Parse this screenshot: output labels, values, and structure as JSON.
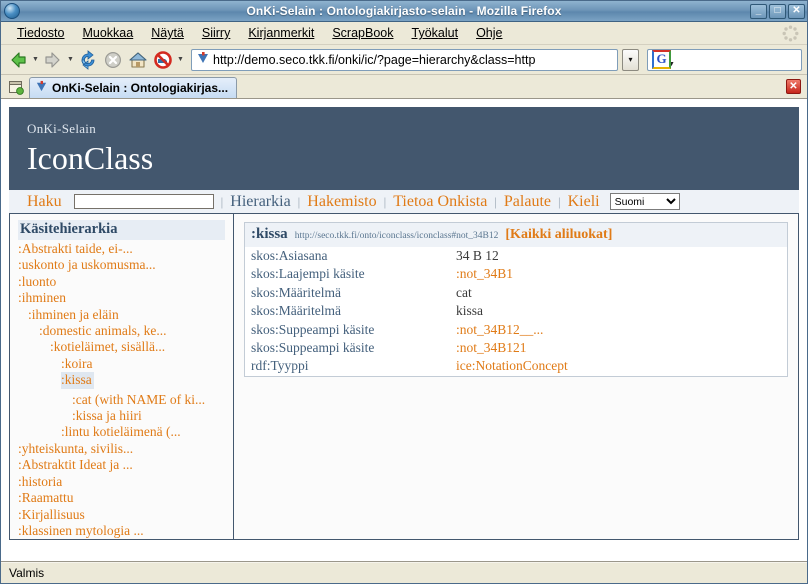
{
  "window": {
    "title": "OnKi-Selain : Ontologiakirjasto-selain - Mozilla Firefox",
    "app_icon": "firefox-globe-icon",
    "minimize": "_",
    "maximize": "□",
    "close": "✕"
  },
  "menubar": {
    "items": [
      {
        "label": "Tiedosto",
        "accel": "T"
      },
      {
        "label": "Muokkaa",
        "accel": "M"
      },
      {
        "label": "Näytä",
        "accel": "N"
      },
      {
        "label": "Siirry",
        "accel": "S"
      },
      {
        "label": "Kirjanmerkit",
        "accel": "K"
      },
      {
        "label": "ScrapBook",
        "accel": "S"
      },
      {
        "label": "Työkalut",
        "accel": "T"
      },
      {
        "label": "Ohje",
        "accel": "O"
      }
    ]
  },
  "toolbar": {
    "back": "back-arrow",
    "forward": "forward-arrow",
    "reload": "reload-icon",
    "stop": "stop-icon",
    "home": "home-icon",
    "adblock": "adblock-icon",
    "url": "http://demo.seco.tkk.fi/onki/ic/?page=hierarchy&class=http",
    "url_dropdown": "▾",
    "search_placeholder": "",
    "search_value": "",
    "search_engine": "G"
  },
  "tabbar": {
    "list_all_tabs": "list-all-tabs-icon",
    "tab_label": "OnKi-Selain : Ontologiakirjas...",
    "close_label": "✕"
  },
  "page": {
    "brand_small": "OnKi-Selain",
    "brand_big": "IconClass",
    "nav": {
      "haku_label": "Haku",
      "haku_value": "",
      "links": [
        {
          "label": "Hierarkia",
          "color": "blue"
        },
        {
          "label": "Hakemisto",
          "color": "orange"
        },
        {
          "label": "Tietoa Onkista",
          "color": "orange"
        },
        {
          "label": "Palaute",
          "color": "orange"
        },
        {
          "label": "Kieli",
          "color": "orange"
        }
      ],
      "separator": "|",
      "language_selected": "Suomi",
      "language_options": [
        "Suomi"
      ]
    },
    "tree": {
      "title": "Käsitehierarkia",
      "nodes": [
        {
          "label": ":Abstrakti taide, ei-...",
          "level": 0,
          "selected": false
        },
        {
          "label": ":uskonto ja uskomusma...",
          "level": 0,
          "selected": false
        },
        {
          "label": ":luonto",
          "level": 0,
          "selected": false
        },
        {
          "label": ":ihminen",
          "level": 0,
          "selected": false
        },
        {
          "label": ":ihminen ja eläin",
          "level": 1,
          "selected": false
        },
        {
          "label": ":domestic animals, ke...",
          "level": 2,
          "selected": false
        },
        {
          "label": ":kotieläimet, sisällä...",
          "level": 3,
          "selected": false
        },
        {
          "label": ":koira",
          "level": 4,
          "selected": false
        },
        {
          "label": ":kissa",
          "level": 4,
          "selected": true
        },
        {
          "label": ":cat (with NAME of ki...",
          "level": 5,
          "selected": false
        },
        {
          "label": ":kissa ja hiiri",
          "level": 5,
          "selected": false
        },
        {
          "label": ":lintu kotieläimenä (...",
          "level": 4,
          "selected": false
        },
        {
          "label": ":yhteiskunta, sivilis...",
          "level": 0,
          "selected": false
        },
        {
          "label": ":Abstraktit Ideat ja ...",
          "level": 0,
          "selected": false
        },
        {
          "label": ":historia",
          "level": 0,
          "selected": false
        },
        {
          "label": ":Raamattu",
          "level": 0,
          "selected": false
        },
        {
          "label": ":Kirjallisuus",
          "level": 0,
          "selected": false
        },
        {
          "label": ":klassinen mytologia ...",
          "level": 0,
          "selected": false
        }
      ]
    },
    "detail": {
      "title": ":kissa",
      "uri": "http://seco.tkk.fi/onto/iconclass/iconclass#not_34B12",
      "all_subclasses": "[Kaikki aliluokat]",
      "rows": [
        {
          "key": "skos:Asiasana",
          "value": "34 B 12",
          "is_link": false
        },
        {
          "key": "skos:Laajempi käsite",
          "value": ":not_34B1",
          "is_link": true
        },
        {
          "key": "skos:Määritelmä",
          "value": "cat",
          "is_link": false
        },
        {
          "key": "skos:Määritelmä",
          "value": "kissa",
          "is_link": false
        },
        {
          "key": "skos:Suppeampi käsite",
          "value": ":not_34B12__...",
          "is_link": true
        },
        {
          "key": "skos:Suppeampi käsite",
          "value": ":not_34B121",
          "is_link": true
        },
        {
          "key": "rdf:Tyyppi",
          "value": "ice:NotationConcept",
          "is_link": true
        }
      ]
    }
  },
  "statusbar": {
    "text": "Valmis"
  },
  "colors": {
    "header_bg": "#43576e",
    "link_orange": "#e07b17",
    "link_blue": "#44607c",
    "selection": "#dfe7f0",
    "chrome_bg": "#ece9d8"
  }
}
